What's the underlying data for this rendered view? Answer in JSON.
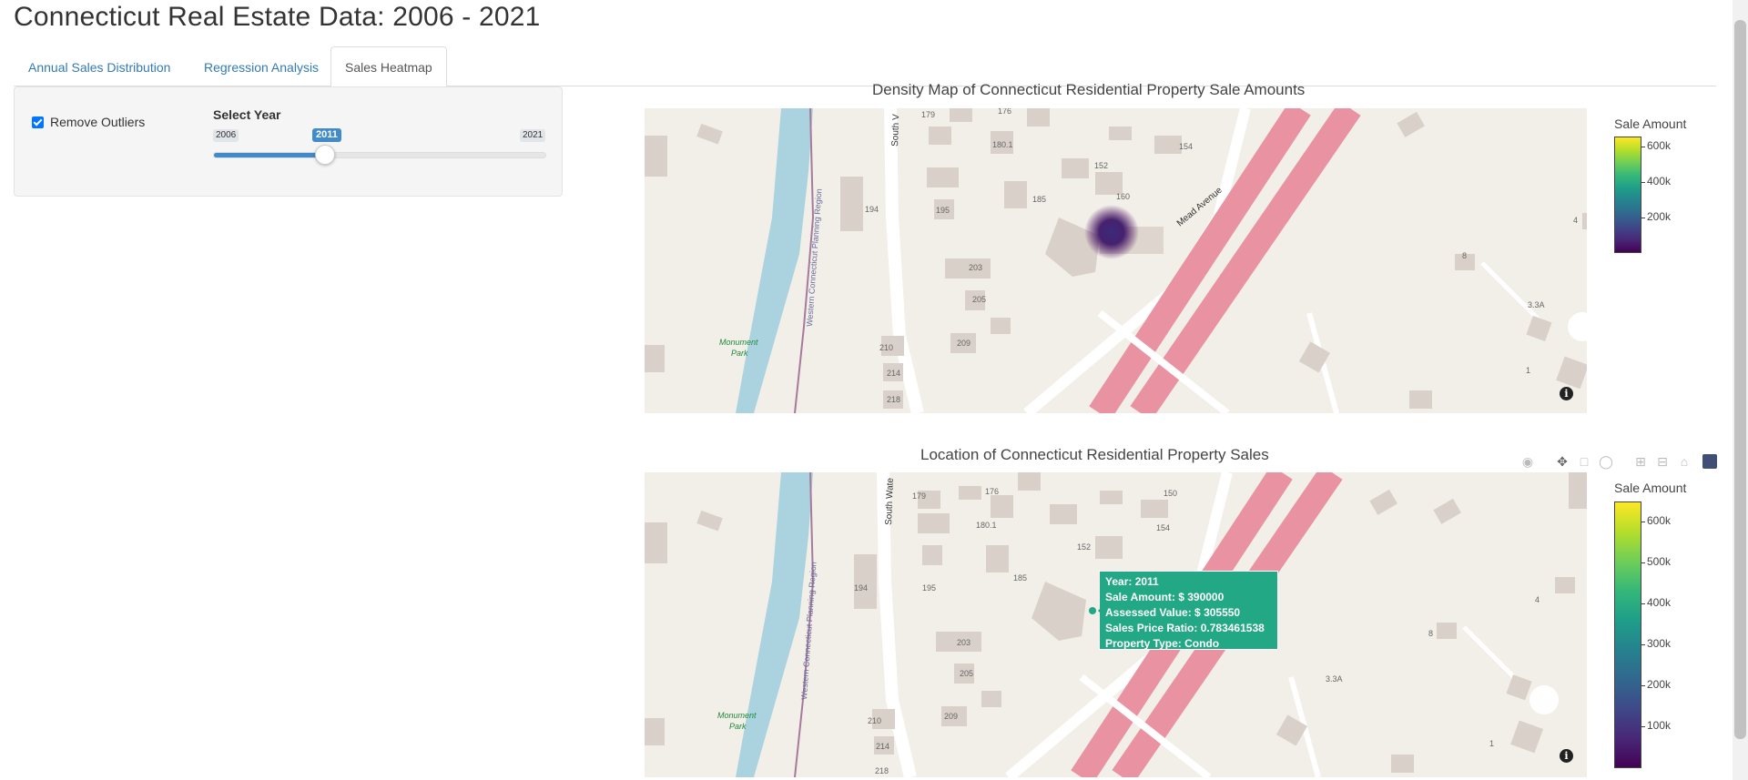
{
  "page": {
    "title": "Connecticut Real Estate Data: 2006 - 2021"
  },
  "tabs": [
    {
      "label": "Annual Sales Distribution",
      "active": false
    },
    {
      "label": "Regression Analysis",
      "active": false
    },
    {
      "label": "Sales Heatmap",
      "active": true
    }
  ],
  "sidebar": {
    "remove_outliers_label": "Remove Outliers",
    "remove_outliers_checked": true,
    "slider": {
      "label": "Select Year",
      "min": "2006",
      "max": "2021",
      "value": "2011",
      "fraction": 0.333
    }
  },
  "map_labels": {
    "monument_park_1": "Monument",
    "monument_park_2": "Park",
    "region": "Western Connecticut Planning Region",
    "mead_avenue": "Mead Avenue",
    "south_water": "South Wate",
    "south_v": "South V",
    "house_numbers": [
      "179",
      "176",
      "180.1",
      "154",
      "152",
      "160",
      "185",
      "195",
      "194",
      "203",
      "205",
      "209",
      "210",
      "214",
      "218",
      "8",
      "4",
      "3.3A",
      "1",
      "150"
    ]
  },
  "density_plot": {
    "title": "Density Map of Connecticut Residential Property Sale Amounts",
    "colorbar_title": "Sale Amount",
    "colorbar_ticks": [
      "600k",
      "400k",
      "200k"
    ]
  },
  "scatter_plot": {
    "title": "Location of Connecticut Residential Property Sales",
    "colorbar_title": "Sale Amount",
    "colorbar_ticks": [
      "600k",
      "500k",
      "400k",
      "300k",
      "200k",
      "100k"
    ],
    "tooltip": {
      "year": "Year:  2011",
      "sale_amount": "Sale Amount: $ 390000",
      "assessed_value": "Assessed Value: $ 305550",
      "ratio": "Sales Price Ratio: 0.783461538",
      "property_type": "Property Type:  Condo"
    }
  },
  "colors": {
    "link": "#337ab7",
    "slider_fill": "#428bca",
    "water": "#aad3df",
    "highway": "#e892a2",
    "building": "#d9d0c9",
    "tooltip_bg": "#22a884"
  },
  "info_icon": "i",
  "modebar_icons": [
    "camera-icon",
    "pan-icon",
    "box-select-icon",
    "lasso-icon",
    "zoom-in-icon",
    "zoom-out-icon",
    "reset-icon",
    "plotly-logo-icon"
  ]
}
